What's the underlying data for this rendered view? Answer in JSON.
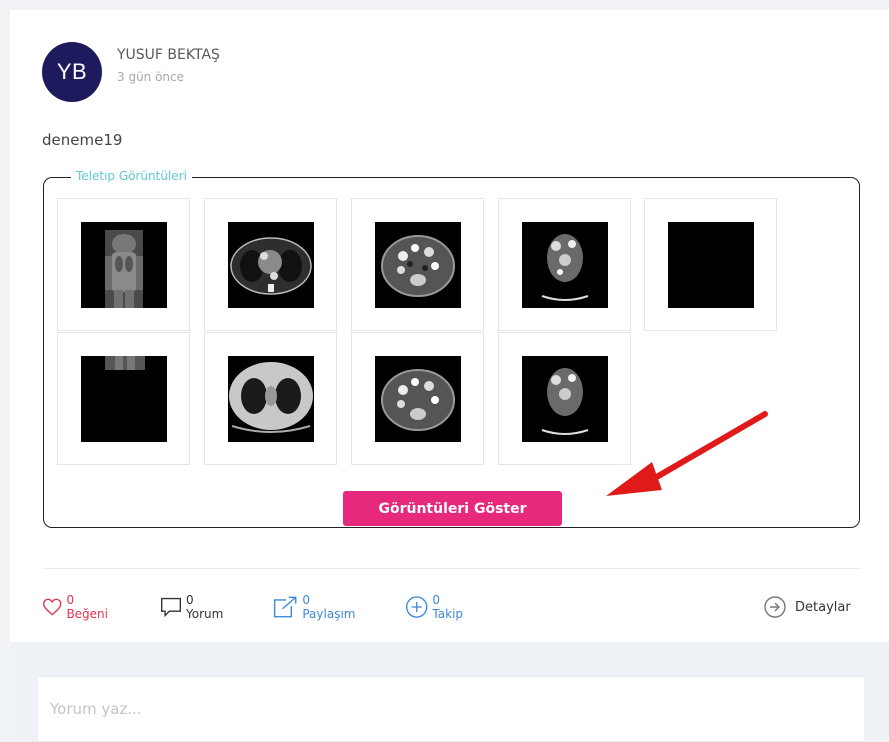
{
  "post": {
    "author_initials": "YB",
    "author_name": "YUSUF BEKTAŞ",
    "time_ago": "3 gün önce",
    "text": "deneme19"
  },
  "gallery": {
    "legend": "Teletıp Görüntüleri",
    "thumbnails": [
      {
        "name": "topogram"
      },
      {
        "name": "thorax-axial"
      },
      {
        "name": "abdomen-axial"
      },
      {
        "name": "neck-axial"
      },
      {
        "name": "blank-black"
      },
      {
        "name": "topogram-partial"
      },
      {
        "name": "lung-axial"
      },
      {
        "name": "abdomen-axial-2"
      },
      {
        "name": "neck-axial-2"
      }
    ],
    "show_button": "Görüntüleri Göster"
  },
  "actions": {
    "like": "0 Beğeni",
    "comment": "0 Yorum",
    "share": "0 Paylaşım",
    "follow": "0 Takip",
    "details": "Detaylar"
  },
  "comment_box": {
    "placeholder": "Yorum yaz..."
  },
  "colors": {
    "avatar_bg": "#1e1a5e",
    "accent_pink": "#e6297c",
    "link_blue": "#3e8ad8",
    "like_red": "#e0344f",
    "legend_teal": "#5ec8d6",
    "arrow_red": "#e01a1a"
  }
}
